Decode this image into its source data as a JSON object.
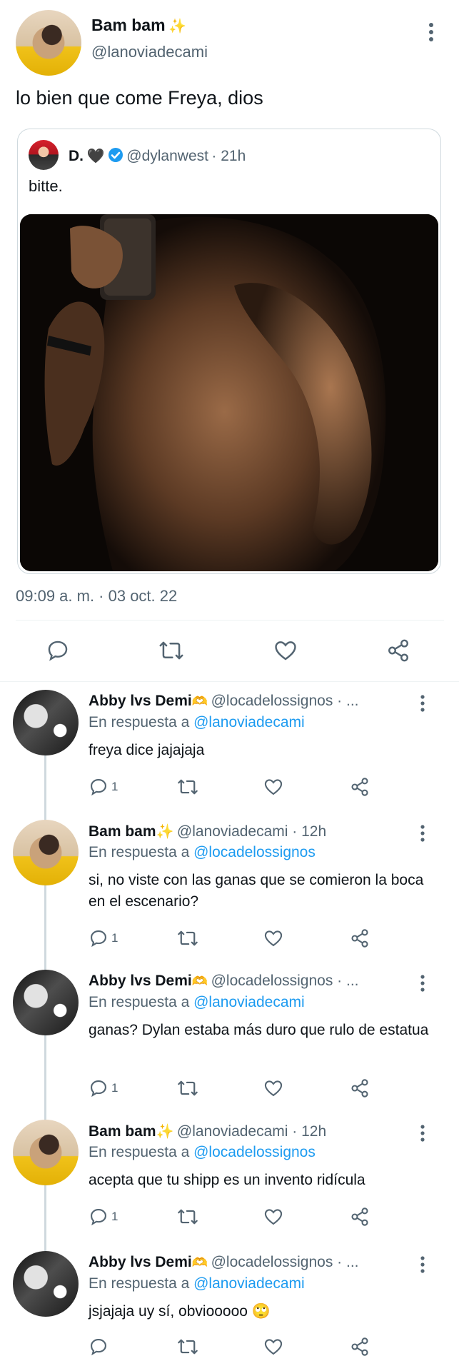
{
  "main_tweet": {
    "name": "Bam bam",
    "name_emoji": "✨",
    "handle": "@lanoviadecami",
    "text": "lo bien que come Freya, dios",
    "timestamp": "09:09 a. m. · 03 oct. 22",
    "quoted": {
      "name": "D.",
      "name_emoji": "🖤",
      "handle": "@dylanwest",
      "age": "· 21h",
      "text": "bitte."
    }
  },
  "replies": [
    {
      "name": "Abby lvs Demi",
      "name_emoji": "🫶",
      "handle": "@locadelossignos · ...",
      "reply_prefix": "En respuesta a",
      "reply_to": "@lanoviadecami",
      "text": "freya dice jajajaja",
      "reply_count": "1"
    },
    {
      "name": "Bam bam",
      "name_emoji": "✨",
      "handle": "@lanoviadecami · 12h",
      "reply_prefix": "En respuesta a",
      "reply_to": "@locadelossignos",
      "text": "si, no viste con las ganas que se comieron la boca en el escenario?",
      "reply_count": "1"
    },
    {
      "name": "Abby lvs Demi",
      "name_emoji": "🫶",
      "handle": "@locadelossignos · ...",
      "reply_prefix": "En respuesta a",
      "reply_to": "@lanoviadecami",
      "text": "ganas? Dylan estaba más duro que rulo de estatua",
      "reply_count": "1"
    },
    {
      "name": "Bam bam",
      "name_emoji": "✨",
      "handle": "@lanoviadecami · 12h",
      "reply_prefix": "En respuesta a",
      "reply_to": "@locadelossignos",
      "text": "acepta que tu shipp es un invento ridícula",
      "reply_count": "1"
    },
    {
      "name": "Abby lvs Demi",
      "name_emoji": "🫶",
      "handle": "@locadelossignos · ...",
      "reply_prefix": "En respuesta a",
      "reply_to": "@lanoviadecami",
      "text": "jsjajaja uy sí, obviooooo 🙄",
      "reply_count": ""
    }
  ],
  "icons": {
    "reply": "speech-bubble-icon",
    "retweet": "retweet-icon",
    "like": "heart-icon",
    "share": "share-icon",
    "more": "more-vertical-icon",
    "verified": "verified-badge-icon"
  },
  "colors": {
    "accent": "#1d9bf0",
    "secondary_text": "#536471",
    "primary_text": "#0f1419",
    "divider": "#eff3f4"
  }
}
